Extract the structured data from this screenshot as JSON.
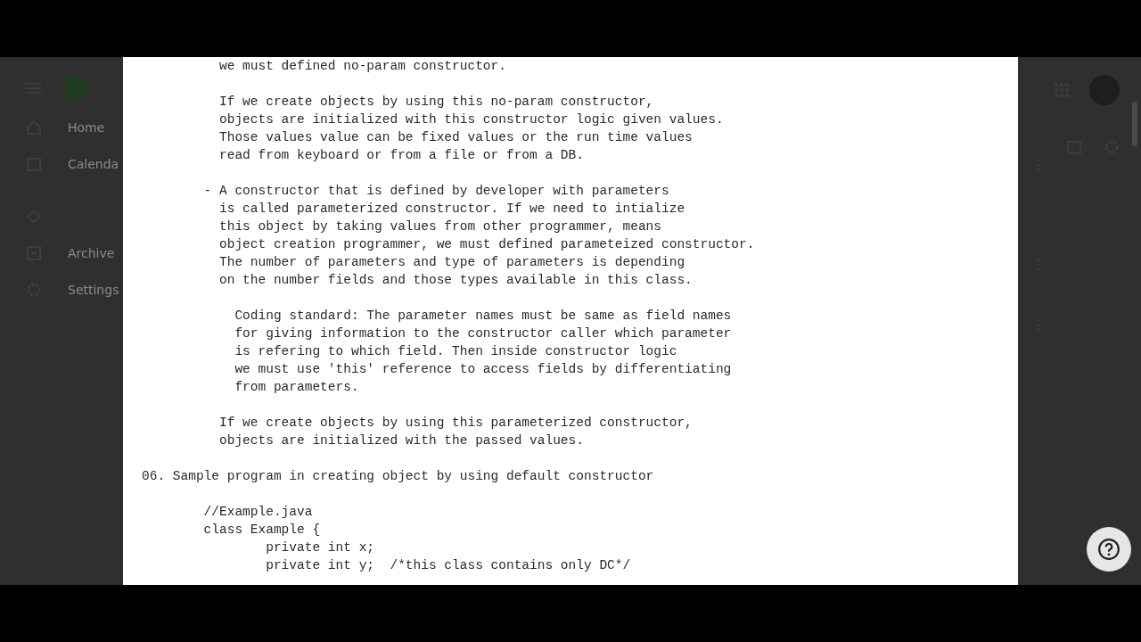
{
  "background_app": {
    "sidebar": {
      "items": [
        {
          "label": "Home",
          "kind": "home"
        },
        {
          "label": "Calenda",
          "kind": "calendar"
        },
        {
          "kind": "tag"
        },
        {
          "label": "Archive",
          "kind": "archive"
        },
        {
          "label": "Settings",
          "kind": "gear"
        }
      ]
    }
  },
  "document": {
    "blocks": [
      {
        "kind": "para",
        "lines": [
          "we must defined no-param constructor."
        ]
      },
      {
        "kind": "para",
        "lines": [
          "If we create objects by using this no-param constructor,",
          "objects are initialized with this constructor logic given values.",
          "Those values value can be fixed values or the run time values",
          "read from keyboard or from a file or from a DB."
        ]
      },
      {
        "kind": "bullet",
        "lines": [
          "- A constructor that is defined by developer with parameters",
          "is called parameterized constructor. If we need to intialize",
          "this object by taking values from other programmer, means",
          "object creation programmer, we must defined parameteized constructor.",
          "The number of parameters and type of parameters is depending",
          "on the number fields and those types available in this class."
        ]
      },
      {
        "kind": "note",
        "lines": [
          "Coding standard: The parameter names must be same as field names",
          "for giving information to the constructor caller which parameter",
          "is refering to which field. Then inside constructor logic",
          "we must use 'this' reference to access fields by differentiating",
          "from parameters."
        ]
      },
      {
        "kind": "para",
        "lines": [
          "If we create objects by using this parameterized constructor,",
          "objects are initialized with the passed values."
        ]
      },
      {
        "kind": "heading",
        "lines": [
          "06. Sample program in creating object by using default constructor"
        ]
      },
      {
        "kind": "code",
        "code": [
          {
            "text": "//Example.java"
          },
          {
            "text": "class Example {",
            "children": [
              {
                "text": "private int x;"
              },
              {
                "text": "private int y;  /*this class contains only DC*/"
              }
            ]
          }
        ]
      }
    ]
  }
}
